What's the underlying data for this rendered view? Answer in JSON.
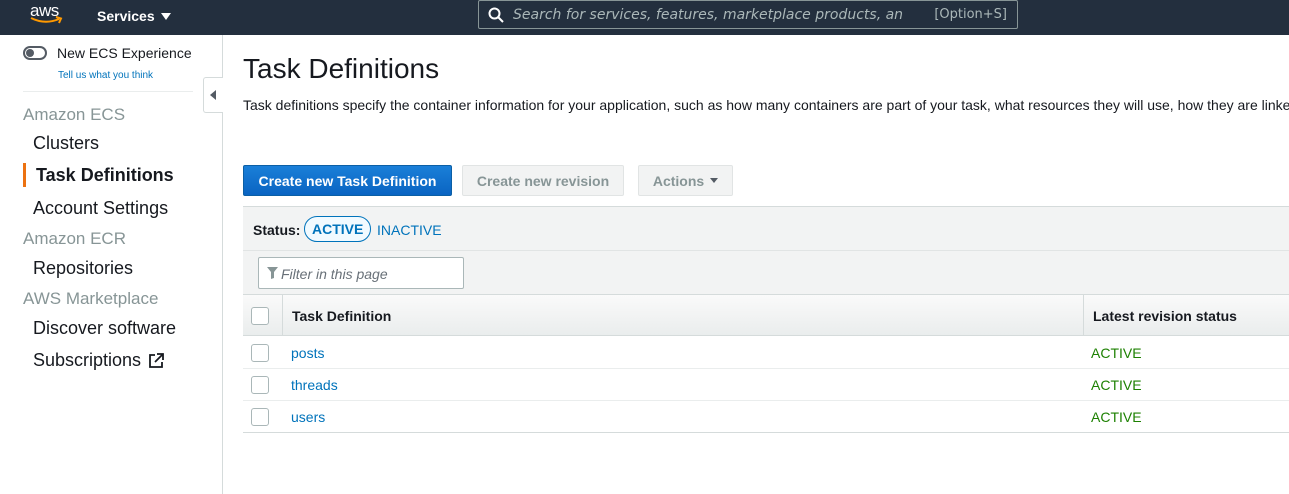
{
  "topnav": {
    "logo_text": "aws",
    "services_label": "Services",
    "search_placeholder": "Search for services, features, marketplace products, and docs",
    "search_shortcut": "[Option+S]"
  },
  "sidebar": {
    "toggle_label": "New ECS Experience",
    "toggle_on": false,
    "feedback_link": "Tell us what you think",
    "sections": [
      {
        "title": "Amazon ECS",
        "items": [
          {
            "label": "Clusters"
          },
          {
            "label": "Task Definitions",
            "active": true
          },
          {
            "label": "Account Settings"
          }
        ]
      },
      {
        "title": "Amazon ECR",
        "items": [
          {
            "label": "Repositories"
          }
        ]
      },
      {
        "title": "AWS Marketplace",
        "items": [
          {
            "label": "Discover software"
          },
          {
            "label": "Subscriptions",
            "icon": "external-link-icon"
          }
        ]
      }
    ]
  },
  "main": {
    "title": "Task Definitions",
    "description": "Task definitions specify the container information for your application, such as how many containers are part of your task, what resources they will use, how they are linked together, and which host ports they will use.",
    "buttons": {
      "create": "Create new Task Definition",
      "revision": "Create new revision",
      "actions": "Actions"
    },
    "status_filter": {
      "label": "Status:",
      "active": "ACTIVE",
      "inactive": "INACTIVE"
    },
    "filter_placeholder": "Filter in this page",
    "table": {
      "columns": [
        "Task Definition",
        "Latest revision status"
      ],
      "rows": [
        {
          "name": "posts",
          "status": "ACTIVE"
        },
        {
          "name": "threads",
          "status": "ACTIVE"
        },
        {
          "name": "users",
          "status": "ACTIVE"
        }
      ]
    }
  },
  "colors": {
    "topbar": "#232f3e",
    "primary": "#0972d3",
    "link": "#0073bb",
    "active_marker": "#ec7211",
    "status_active": "#1d8102"
  }
}
